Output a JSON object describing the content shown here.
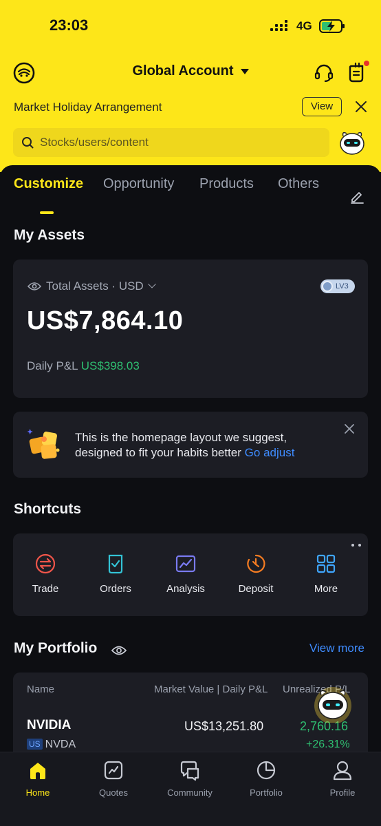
{
  "status_bar": {
    "time": "23:03",
    "network": "4G"
  },
  "header": {
    "account_title": "Global Account"
  },
  "notice": {
    "text": "Market Holiday Arrangement",
    "view_label": "View"
  },
  "search": {
    "placeholder": "Stocks/users/content"
  },
  "tabs": [
    {
      "label": "Customize",
      "active": true
    },
    {
      "label": "Opportunity",
      "active": false
    },
    {
      "label": "Products",
      "active": false
    },
    {
      "label": "Others",
      "active": false
    }
  ],
  "my_assets": {
    "title": "My Assets",
    "label": "Total Assets · USD",
    "level_badge": "LV3",
    "total_value": "US$7,864.10",
    "daily_pnl_label": "Daily P&L",
    "daily_pnl_value": "US$398.03"
  },
  "suggestion": {
    "text": "This is the homepage layout we suggest, designed to fit your habits better",
    "link": "Go adjust"
  },
  "shortcuts": {
    "title": "Shortcuts",
    "items": [
      {
        "label": "Trade",
        "icon": "trade-icon",
        "color": "#f0554a"
      },
      {
        "label": "Orders",
        "icon": "orders-icon",
        "color": "#33c3d6"
      },
      {
        "label": "Analysis",
        "icon": "analysis-icon",
        "color": "#7a7bf2"
      },
      {
        "label": "Deposit",
        "icon": "deposit-icon",
        "color": "#f57c22"
      },
      {
        "label": "More",
        "icon": "grid-icon",
        "color": "#3fa6ff"
      }
    ]
  },
  "portfolio": {
    "title": "My Portfolio",
    "view_more": "View more",
    "columns": {
      "name": "Name",
      "market_value": "Market Value | Daily P&L",
      "unrealized": "Unrealized P/L"
    },
    "rows": [
      {
        "name": "NVIDIA",
        "market": "US",
        "code": "NVDA",
        "market_value": "US$13,251.80",
        "pl_value": "2,760.16",
        "pl_pct": "+26.31%"
      }
    ]
  },
  "bottom_nav": [
    {
      "label": "Home",
      "active": true
    },
    {
      "label": "Quotes",
      "active": false
    },
    {
      "label": "Community",
      "active": false
    },
    {
      "label": "Portfolio",
      "active": false
    },
    {
      "label": "Profile",
      "active": false
    }
  ],
  "colors": {
    "brand_yellow": "#fde619",
    "background": "#0d0e12",
    "card": "#1c1d24",
    "gain_green": "#2fbf71",
    "link_blue": "#3f8cff"
  }
}
